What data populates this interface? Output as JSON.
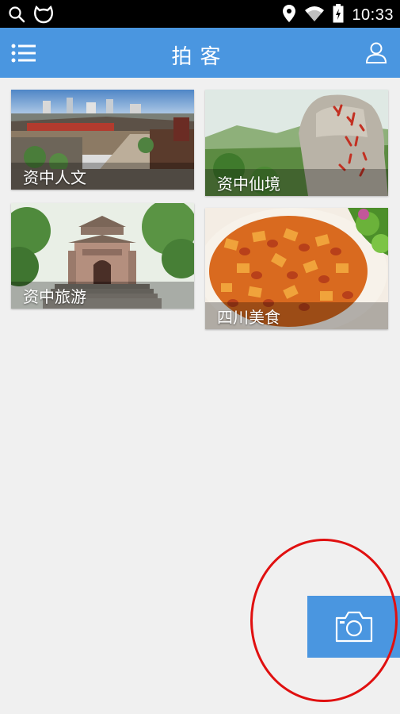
{
  "status_bar": {
    "time": "10:33",
    "icons_left": [
      "search-icon",
      "cat-face-icon"
    ],
    "icons_right": [
      "location-pin-icon",
      "wifi-icon",
      "battery-icon"
    ]
  },
  "app_bar": {
    "title": "拍客",
    "left_icon": "menu-list-icon",
    "right_icon": "user-icon",
    "color": "#4a96e0"
  },
  "cards": [
    {
      "label": "资中人文"
    },
    {
      "label": "资中仙境"
    },
    {
      "label": "资中旅游"
    },
    {
      "label": "四川美食"
    }
  ],
  "fab": {
    "icon": "camera-icon",
    "color": "#4a96e0"
  },
  "annotation": {
    "color": "#e01010"
  }
}
